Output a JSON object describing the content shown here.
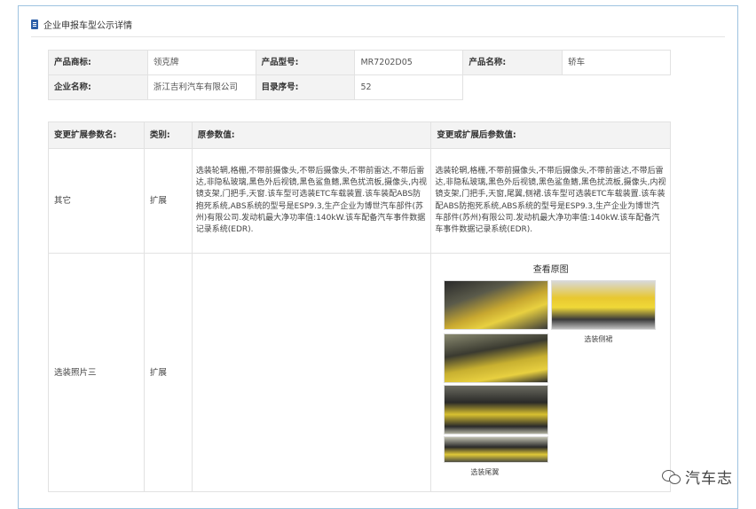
{
  "header": {
    "title": "企业申报车型公示详情"
  },
  "info": {
    "row1": [
      {
        "label": "产品商标:",
        "value": "领克牌"
      },
      {
        "label": "产品型号:",
        "value": "MR7202D05"
      },
      {
        "label": "产品名称:",
        "value": "轿车"
      }
    ],
    "row2": [
      {
        "label": "企业名称:",
        "value": "浙江吉利汽车有限公司"
      },
      {
        "label": "目录序号:",
        "value": "52"
      }
    ]
  },
  "changes": {
    "headers": [
      "变更扩展参数名:",
      "类别:",
      "原参数值:",
      "变更或扩展后参数值:"
    ],
    "rows": [
      {
        "name": "其它",
        "category": "扩展",
        "original": "选装轮辋,格栅,不带前摄像头,不带后摄像头,不带前雷达,不带后雷达,非隐私玻璃,黑色外后视镜,黑色鲨鱼鳍,黑色扰流板,摄像头,内视镜支架,门把手,天窗.该车型可选装ETC车载装置.该车装配ABS防抱死系统,ABS系统的型号是ESP9.3,生产企业为博世汽车部件(苏州)有限公司.发动机最大净功率值:140kW.该车配备汽车事件数据记录系统(EDR).",
        "changed": "选装轮辋,格栅,不带前摄像头,不带后摄像头,不带前雷达,不带后雷达,非隐私玻璃,黑色外后视镜,黑色鲨鱼鳍,黑色扰流板,摄像头,内视镜支架,门把手,天窗,尾翼,侧裙.该车型可选装ETC车载装置.该车装配ABS防抱死系统,ABS系统的型号是ESP9.3,生产企业为博世汽车部件(苏州)有限公司.发动机最大净功率值:140kW.该车配备汽车事件数据记录系统(EDR)."
      },
      {
        "name": "选装照片三",
        "category": "扩展",
        "original": "",
        "photos": {
          "title": "查看原图",
          "caption_side_skirt": "选装侧裙",
          "caption_rear_wing": "选装尾翼"
        }
      }
    ]
  },
  "watermark": {
    "text": "汽车志"
  }
}
